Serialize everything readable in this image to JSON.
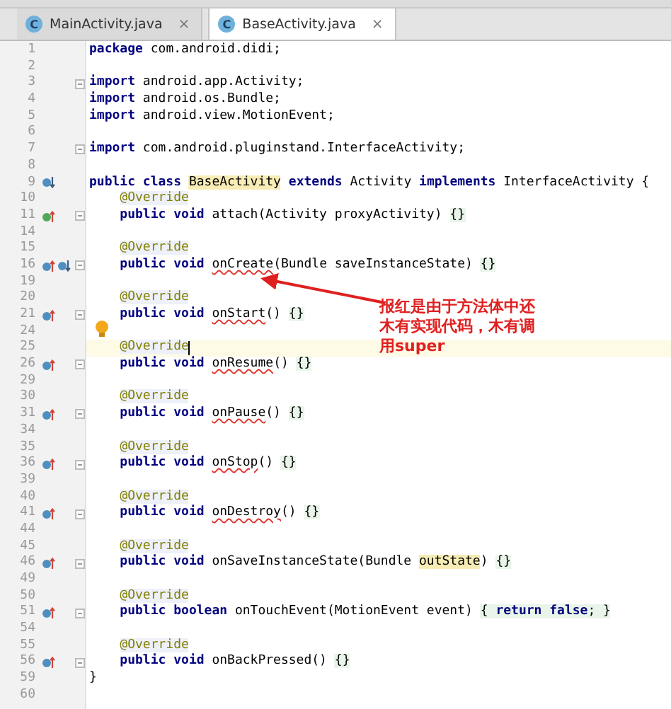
{
  "tabs": [
    {
      "icon_letter": "C",
      "label": "MainActivity.java",
      "close": "×",
      "selected": false
    },
    {
      "icon_letter": "C",
      "label": "BaseActivity.java",
      "close": "×",
      "selected": true
    }
  ],
  "lines": [
    {
      "number": "1",
      "segments": [
        {
          "t": "package",
          "kind": "kw"
        },
        {
          "t": " com.android.didi;",
          "kind": "plain"
        }
      ]
    },
    {
      "number": "2"
    },
    {
      "number": "3",
      "fold": true,
      "segments": [
        {
          "t": "import",
          "kind": "kw"
        },
        {
          "t": " android.app.Activity;",
          "kind": "plain"
        }
      ]
    },
    {
      "number": "4",
      "segments": [
        {
          "t": "import",
          "kind": "kw"
        },
        {
          "t": " android.os.Bundle;",
          "kind": "plain"
        }
      ]
    },
    {
      "number": "5",
      "segments": [
        {
          "t": "import",
          "kind": "kw"
        },
        {
          "t": " android.view.MotionEvent;",
          "kind": "plain"
        }
      ]
    },
    {
      "number": "6"
    },
    {
      "number": "7",
      "fold": true,
      "segments": [
        {
          "t": "import",
          "kind": "kw"
        },
        {
          "t": " com.android.pluginstand.InterfaceActivity;",
          "kind": "plain"
        }
      ]
    },
    {
      "number": "8"
    },
    {
      "number": "9",
      "markers": [
        {
          "kind": "implemented"
        }
      ],
      "segments": [
        {
          "t": "public class ",
          "kind": "kw"
        },
        {
          "t": "BaseActivity",
          "kind": "sym"
        },
        {
          "t": " extends",
          "kind": "kw"
        },
        {
          "t": " Activity ",
          "kind": "plain"
        },
        {
          "t": "implements",
          "kind": "kw"
        },
        {
          "t": " InterfaceActivity {",
          "kind": "plain"
        }
      ]
    },
    {
      "number": "10",
      "indented": true,
      "segments": [
        {
          "t": "@Override",
          "kind": "anno"
        }
      ]
    },
    {
      "number": "11",
      "indented": true,
      "markers": [
        {
          "kind": "implements"
        }
      ],
      "fold": true,
      "segments": [
        {
          "t": "public void",
          "kind": "kw"
        },
        {
          "t": " attach(Activity proxyActivity) ",
          "kind": "plain"
        },
        {
          "t": "{}",
          "kind": "brace"
        }
      ]
    },
    {
      "number": "14"
    },
    {
      "number": "15",
      "indented": true,
      "segments": [
        {
          "t": "@Override",
          "kind": "anno"
        }
      ]
    },
    {
      "number": "16",
      "indented": true,
      "markers": [
        {
          "kind": "overrides"
        },
        {
          "kind": "implemented"
        }
      ],
      "fold": true,
      "segments": [
        {
          "t": "public void ",
          "kind": "kw"
        },
        {
          "t": "onCreate",
          "kind": "err"
        },
        {
          "t": "(Bundle saveInstanceState) ",
          "kind": "plain"
        },
        {
          "t": "{}",
          "kind": "brace"
        }
      ]
    },
    {
      "number": "19"
    },
    {
      "number": "20",
      "indented": true,
      "segments": [
        {
          "t": "@Override",
          "kind": "anno"
        }
      ]
    },
    {
      "number": "21",
      "indented": true,
      "markers": [
        {
          "kind": "overrides"
        }
      ],
      "fold": true,
      "segments": [
        {
          "t": "public void ",
          "kind": "kw"
        },
        {
          "t": "onStart",
          "kind": "err"
        },
        {
          "t": "() ",
          "kind": "plain"
        },
        {
          "t": "{}",
          "kind": "brace"
        }
      ]
    },
    {
      "number": "24",
      "bulb": true
    },
    {
      "number": "25",
      "indented": true,
      "current": true,
      "caret": true,
      "segments": [
        {
          "t": "@Override",
          "kind": "anno"
        }
      ]
    },
    {
      "number": "26",
      "indented": true,
      "markers": [
        {
          "kind": "overrides"
        }
      ],
      "fold": true,
      "segments": [
        {
          "t": "public void ",
          "kind": "kw"
        },
        {
          "t": "onResume",
          "kind": "err"
        },
        {
          "t": "() ",
          "kind": "plain"
        },
        {
          "t": "{}",
          "kind": "brace"
        }
      ]
    },
    {
      "number": "29"
    },
    {
      "number": "30",
      "indented": true,
      "segments": [
        {
          "t": "@Override",
          "kind": "anno"
        }
      ]
    },
    {
      "number": "31",
      "indented": true,
      "markers": [
        {
          "kind": "overrides"
        }
      ],
      "fold": true,
      "segments": [
        {
          "t": "public void ",
          "kind": "kw"
        },
        {
          "t": "onPause",
          "kind": "err"
        },
        {
          "t": "() ",
          "kind": "plain"
        },
        {
          "t": "{}",
          "kind": "brace"
        }
      ]
    },
    {
      "number": "34"
    },
    {
      "number": "35",
      "indented": true,
      "segments": [
        {
          "t": "@Override",
          "kind": "anno"
        }
      ]
    },
    {
      "number": "36",
      "indented": true,
      "markers": [
        {
          "kind": "overrides"
        }
      ],
      "fold": true,
      "segments": [
        {
          "t": "public void ",
          "kind": "kw"
        },
        {
          "t": "onStop",
          "kind": "err"
        },
        {
          "t": "() ",
          "kind": "plain"
        },
        {
          "t": "{}",
          "kind": "brace"
        }
      ]
    },
    {
      "number": "39"
    },
    {
      "number": "40",
      "indented": true,
      "segments": [
        {
          "t": "@Override",
          "kind": "anno"
        }
      ]
    },
    {
      "number": "41",
      "indented": true,
      "markers": [
        {
          "kind": "overrides"
        }
      ],
      "fold": true,
      "segments": [
        {
          "t": "public void ",
          "kind": "kw"
        },
        {
          "t": "onDestroy",
          "kind": "err"
        },
        {
          "t": "() ",
          "kind": "plain"
        },
        {
          "t": "{}",
          "kind": "brace"
        }
      ]
    },
    {
      "number": "44"
    },
    {
      "number": "45",
      "indented": true,
      "segments": [
        {
          "t": "@Override",
          "kind": "anno"
        }
      ]
    },
    {
      "number": "46",
      "indented": true,
      "markers": [
        {
          "kind": "overrides"
        }
      ],
      "fold": true,
      "segments": [
        {
          "t": "public void",
          "kind": "kw"
        },
        {
          "t": " onSaveInstanceState(Bundle ",
          "kind": "plain"
        },
        {
          "t": "outState",
          "kind": "sym"
        },
        {
          "t": ") ",
          "kind": "plain"
        },
        {
          "t": "{}",
          "kind": "brace"
        }
      ]
    },
    {
      "number": "49"
    },
    {
      "number": "50",
      "indented": true,
      "segments": [
        {
          "t": "@Override",
          "kind": "anno"
        }
      ]
    },
    {
      "number": "51",
      "indented": true,
      "markers": [
        {
          "kind": "overrides"
        }
      ],
      "fold": true,
      "segments": [
        {
          "t": "public boolean",
          "kind": "kw"
        },
        {
          "t": " onTouchEvent(MotionEvent event) ",
          "kind": "plain"
        },
        {
          "t": "{ ",
          "kind": "brace"
        },
        {
          "t": "return false",
          "kind": "brace_kw"
        },
        {
          "t": "; }",
          "kind": "brace"
        }
      ]
    },
    {
      "number": "54"
    },
    {
      "number": "55",
      "indented": true,
      "segments": [
        {
          "t": "@Override",
          "kind": "anno"
        }
      ]
    },
    {
      "number": "56",
      "indented": true,
      "markers": [
        {
          "kind": "overrides"
        }
      ],
      "fold": true,
      "segments": [
        {
          "t": "public void",
          "kind": "kw"
        },
        {
          "t": " onBackPressed() ",
          "kind": "plain"
        },
        {
          "t": "{}",
          "kind": "brace"
        }
      ]
    },
    {
      "number": "59",
      "segments": [
        {
          "t": "}",
          "kind": "plain"
        }
      ]
    },
    {
      "number": "60"
    }
  ],
  "callout": {
    "text": "报红是由于方法体中还木有实现代码，木有调用super"
  }
}
